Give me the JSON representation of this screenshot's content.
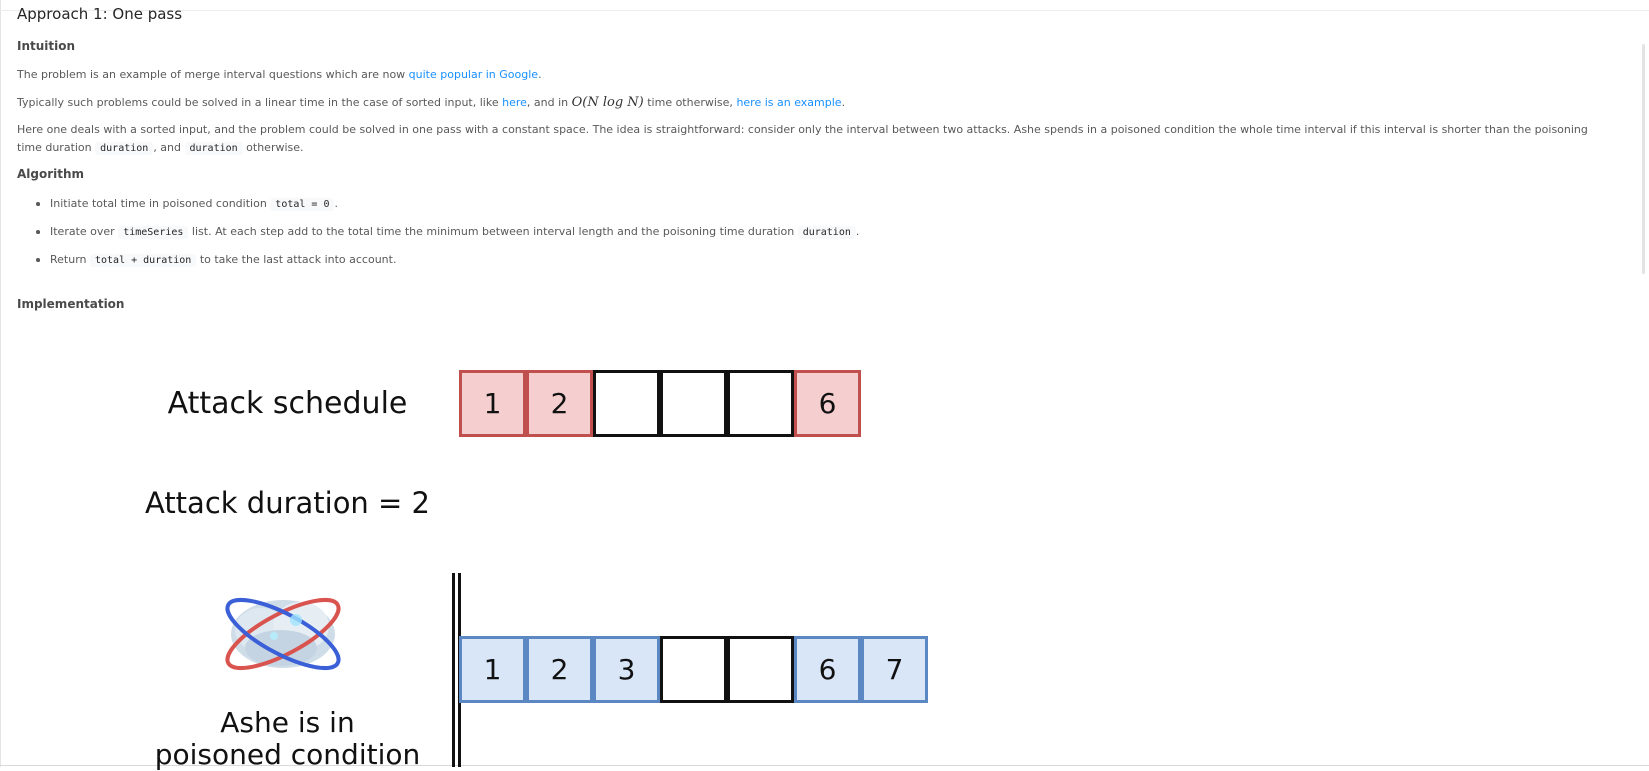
{
  "article": {
    "title": "Approach 1: One pass",
    "intuition_heading": "Intuition",
    "p1_text": "The problem is an example of merge interval questions which are now ",
    "p1_link": "quite popular in Google",
    "p1_end": ".",
    "p2_text": "Typically such problems could be solved in a linear time in the case of sorted input, like ",
    "p2_link1": "here",
    "p2_mid": ", and in ",
    "p2_math": "O(N log N)",
    "p2_after": " time otherwise, ",
    "p2_link2": "here is an example",
    "p2_end": ".",
    "p3_text": "Here one deals with a sorted input, and the problem could be solved in one pass with a constant space. The idea is straightforward: consider only the interval between two attacks. Ashe spends in a poisoned condition the whole time interval if this interval is shorter than the poisoning time duration ",
    "p3_code1": "duration",
    "p3_mid": ", and ",
    "p3_code2": "duration",
    "p3_end": " otherwise.",
    "algorithm_heading": "Algorithm",
    "alg1_text": "Initiate total time in poisoned condition ",
    "alg1_code": "total = 0",
    "alg1_end": ".",
    "alg2_text": "Iterate over ",
    "alg2_code": "timeSeries",
    "alg2_mid": " list. At each step add to the total time the minimum between interval length and the poisoning time duration ",
    "alg2_code2": "duration",
    "alg2_end": ".",
    "alg3_text": "Return ",
    "alg3_code": "total + duration",
    "alg3_end": " to take the last attack into account.",
    "implementation_heading": "Implementation"
  },
  "diagram": {
    "schedule_label": "Attack schedule",
    "duration_label": "Attack duration = 2",
    "ashe_label_1": "Ashe is in",
    "ashe_label_2": "poisoned condition",
    "schedule_cells": [
      "1",
      "2",
      "",
      "",
      "",
      "6"
    ],
    "poison_cells": [
      "1",
      "2",
      "3",
      "",
      "",
      "6",
      "7"
    ],
    "colors": {
      "attack": "#f5cfcf",
      "poisoned": "#d9e6f8",
      "link": "#1890ff"
    }
  }
}
